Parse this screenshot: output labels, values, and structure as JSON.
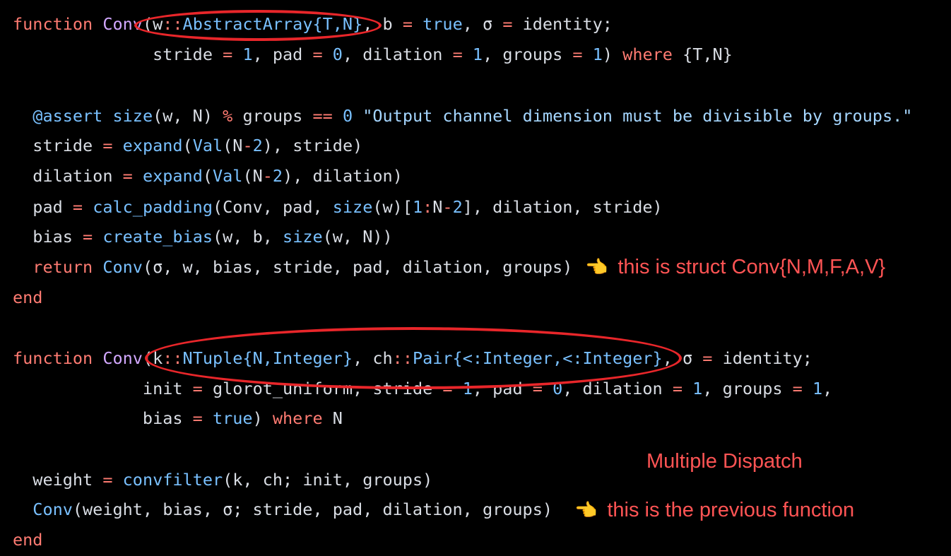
{
  "code": {
    "f1": {
      "kw_function": "function",
      "name": "Conv",
      "paren": "(",
      "arg_w": "w",
      "colons1": "::",
      "type_abstract": "AbstractArray{T,N}",
      "b_part": ", b ",
      "eq1": "=",
      "true1": "true",
      "sigma_part": ", σ ",
      "eq2": "=",
      "identity_semi": " identity;",
      "indent2": "              stride ",
      "eq3": "=",
      "one1": "1",
      "pad_txt": ", pad ",
      "eq4": "=",
      "zero1": "0",
      "dil_txt": ", dilation ",
      "eq5": "=",
      "one2": "1",
      "grp_txt": ", groups ",
      "eq6": "=",
      "one3": "1",
      "close_where": ") ",
      "kw_where": "where",
      "tn": " {T,N}",
      "assert_macro": "@assert",
      "size_call": "size",
      "assert_args": "(w, N) ",
      "pct": "%",
      "groups_txt": " groups ",
      "eqeq": "==",
      "zero2": "0",
      "assert_msg": "\"Output channel dimension must be divisible by groups.\"",
      "stride_lhs": "  stride ",
      "eq7": "=",
      "expand1": "expand",
      "val1": "Val",
      "n_minus_1": "(N",
      "minus1": "-",
      "two1": "2",
      "stride_rhs": "), stride)",
      "dil_lhs": "  dilation ",
      "eq8": "=",
      "expand2": "expand",
      "val2": "Val",
      "n_minus_2": "(N",
      "minus2": "-",
      "two2": "2",
      "dil_rhs": "), dilation)",
      "pad_lhs": "  pad ",
      "eq9": "=",
      "calc_padding": "calc_padding",
      "calc_args1": "(Conv, pad, ",
      "size2": "size",
      "calc_args2": "(w)[",
      "one4": "1",
      "colon2": ":",
      "calc_n": "N",
      "minus3": "-",
      "two3": "2",
      "calc_args3": "], dilation, stride)",
      "bias_lhs": "  bias ",
      "eq10": "=",
      "create_bias": "create_bias",
      "cb_args1": "(w, b, ",
      "size3": "size",
      "cb_args2": "(w, N))",
      "ret_indent": "  ",
      "kw_return": "return",
      "conv_call": "Conv",
      "ret_args": "(σ, w, bias, stride, pad, dilation, groups)",
      "kw_end": "end"
    },
    "f2": {
      "kw_function": "function",
      "name": "Conv",
      "paren": "(",
      "arg_k": "k",
      "colons1": "::",
      "type_ntuple": "NTuple{N,Integer}",
      "ch_txt": ", ch",
      "colons2": "::",
      "type_pair": "Pair{<:Integer,<:Integer}",
      "sigma_part": ", σ ",
      "eq1": "=",
      "identity_semi": " identity;",
      "init_indent": "             init ",
      "eq2": "=",
      "glorot": " glorot_uniform, stride ",
      "eq3": "=",
      "one1": "1",
      "pad_txt": ", pad ",
      "eq4": "=",
      "zero1": "0",
      "dil_txt": ", dilation ",
      "eq5": "=",
      "one2": "1",
      "grp_txt": ", groups ",
      "eq6": "=",
      "one3": "1",
      "comma_end": ",",
      "bias_indent": "             bias ",
      "eq7": "=",
      "true1": "true",
      "close": ") ",
      "kw_where": "where",
      "n_txt": " N",
      "weight_lhs": "  weight ",
      "eq8": "=",
      "convfilter": "convfilter",
      "cf_args": "(k, ch; init, groups)",
      "conv_indent": "  ",
      "conv_call": "Conv",
      "conv_args": "(weight, bias, σ; stride, pad, dilation, groups)",
      "kw_end": "end"
    }
  },
  "annotations": {
    "struct_note": "this is struct Conv{N,M,F,A,V}",
    "dispatch_title": "Multiple Dispatch",
    "prev_note": "this is the previous function",
    "hand_glyph": "👈"
  },
  "colors": {
    "background": "#000000",
    "keyword": "#ff7b72",
    "function_name": "#d2a8ff",
    "builtin": "#79c0ff",
    "string": "#a5d6ff",
    "annotation": "#ff5454",
    "ellipse": "#e8262a"
  }
}
